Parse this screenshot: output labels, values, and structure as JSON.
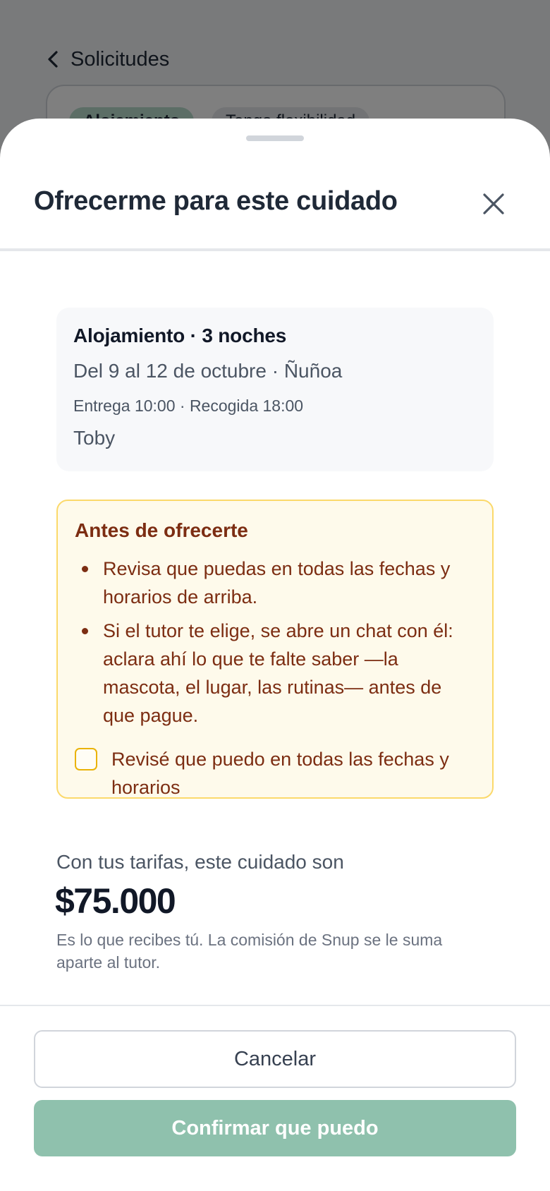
{
  "background": {
    "back_label": "Solicitudes",
    "chips": [
      "Alojamiento",
      "Tengo flexibilidad"
    ]
  },
  "sheet": {
    "title": "Ofrecerme para este cuidado",
    "summary": {
      "title": "Alojamiento · 3 noches",
      "dates": "Del 9 al 12 de octubre · Ñuñoa",
      "times": "Entrega 10:00 · Recogida 18:00",
      "pet": "Toby"
    },
    "notice": {
      "title": "Antes de ofrecerte",
      "items": [
        "Revisa que puedas en todas las fechas y horarios de arriba.",
        "Si el tutor te elige, se abre un chat con él: aclara ahí lo que te falte saber —la mascota, el lugar, las rutinas— antes de que pague."
      ],
      "checkbox_label": "Revisé que puedo en todas las fechas y horarios",
      "checkbox_checked": false
    },
    "price": {
      "label": "Con tus tarifas, este cuidado son",
      "value": "$75.000",
      "note": "Es lo que recibes tú. La comisión de Snup se le suma aparte al tutor."
    },
    "buttons": {
      "cancel": "Cancelar",
      "confirm": "Confirmar que puedo",
      "confirm_enabled": false
    }
  },
  "colors": {
    "accent_disabled": "#8fc1ad",
    "notice_bg": "#fefaeb",
    "notice_border": "#fbd96b",
    "notice_text": "#7c2d12"
  },
  "icons": {
    "back": "chevron-left-icon",
    "close": "close-icon"
  }
}
